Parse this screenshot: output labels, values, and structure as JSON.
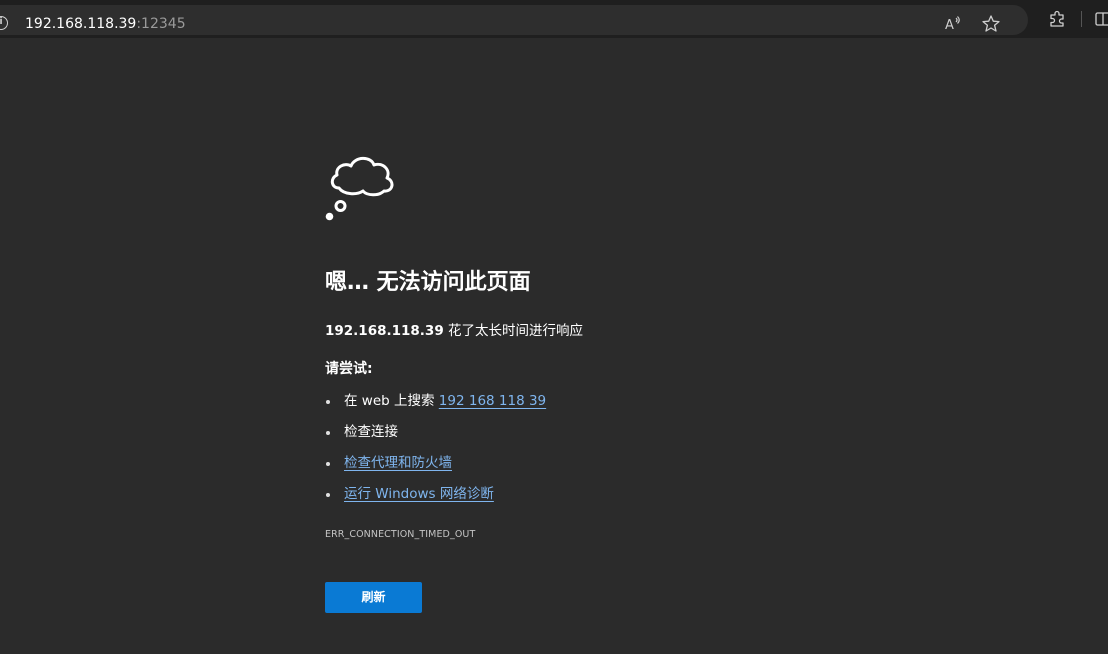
{
  "browser": {
    "url_host": "192.168.118.39",
    "url_port": ":12345",
    "icons": {
      "info": "info-icon",
      "read_aloud": "read-aloud-icon",
      "favorite": "favorite-star-icon",
      "extensions": "extensions-puzzle-icon",
      "split_screen": "split-screen-icon"
    }
  },
  "error_page": {
    "icon": "cloud-thought-icon",
    "title": "嗯… 无法访问此页面",
    "host": "192.168.118.39",
    "description_suffix": " 花了太长时间进行响应",
    "try_heading": "请尝试:",
    "suggestions": {
      "search_prefix": "在 web 上搜索 ",
      "search_link": "192 168 118 39",
      "check_connection": "检查连接",
      "check_proxy": "检查代理和防火墙",
      "run_diagnostics": "运行 Windows 网络诊断"
    },
    "error_code": "ERR_CONNECTION_TIMED_OUT",
    "refresh_label": "刷新"
  },
  "colors": {
    "page_background": "#2b2b2b",
    "link": "#7fb5ee",
    "button": "#0a7ad4"
  }
}
